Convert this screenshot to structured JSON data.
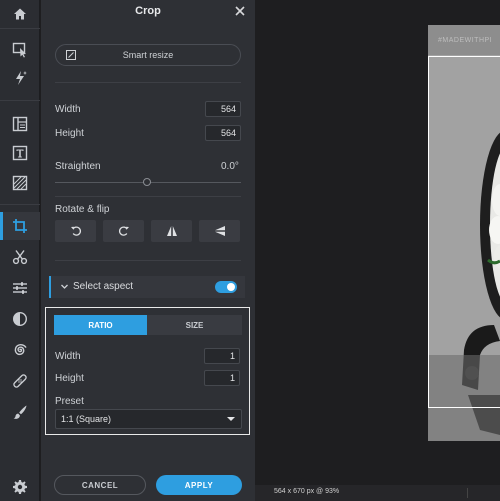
{
  "rail": {
    "tools": [
      {
        "name": "home-icon"
      },
      {
        "name": "select-icon"
      },
      {
        "name": "magic-icon"
      },
      {
        "name": "layout-icon"
      },
      {
        "name": "text-icon"
      },
      {
        "name": "texture-icon"
      },
      {
        "name": "crop-icon",
        "active": true
      },
      {
        "name": "cutout-icon"
      },
      {
        "name": "adjust-icon"
      },
      {
        "name": "contrast-icon"
      },
      {
        "name": "spiral-icon"
      },
      {
        "name": "healing-icon"
      },
      {
        "name": "brush-icon"
      },
      {
        "name": "settings-icon"
      }
    ]
  },
  "panel": {
    "title": "Crop",
    "smart_resize": "Smart resize",
    "width_label": "Width",
    "width_value": "564",
    "height_label": "Height",
    "height_value": "564",
    "straighten_label": "Straighten",
    "straighten_value": "0.0°",
    "straighten_level": 0.5,
    "rotate_flip_label": "Rotate & flip",
    "select_aspect_label": "Select aspect",
    "select_aspect_on": true,
    "tabs": {
      "ratio": "RATIO",
      "size": "SIZE"
    },
    "ratio_width_label": "Width",
    "ratio_width_value": "1",
    "ratio_height_label": "Height",
    "ratio_height_value": "1",
    "preset_label": "Preset",
    "preset_value": "1:1 (Square)",
    "cancel_label": "CANCEL",
    "apply_label": "APPLY"
  },
  "canvas": {
    "watermark": "#MADEWITHPI",
    "status": "564 x 670 px @ 93%"
  },
  "colors": {
    "accent": "#2e9ee0",
    "panel": "#2e3035",
    "rail": "#2b2d32",
    "canvas": "#1e1e20"
  }
}
